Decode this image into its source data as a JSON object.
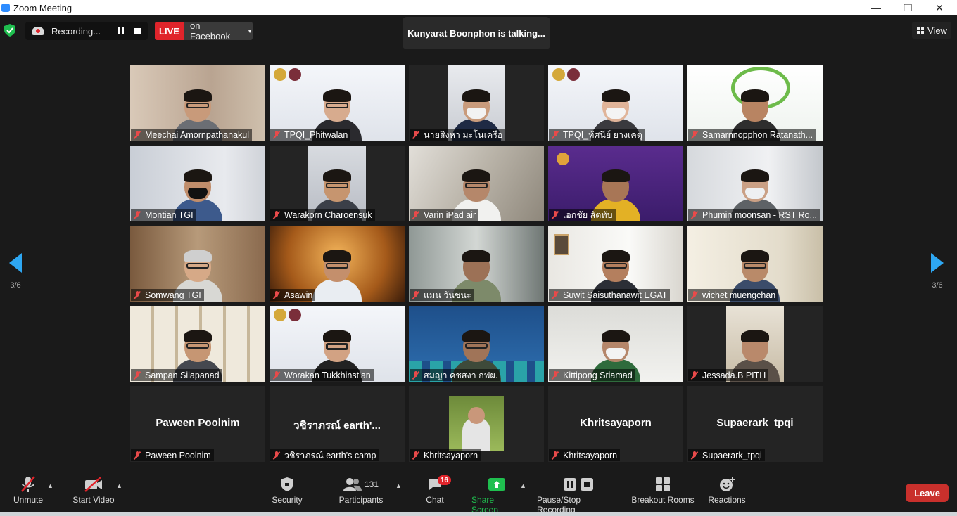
{
  "window": {
    "title": "Zoom Meeting",
    "minimize": "—",
    "maximize": "❐",
    "close": "✕"
  },
  "topbar": {
    "recording_label": "Recording...",
    "live_label": "LIVE",
    "live_target": "on Facebook",
    "talking": "Kunyarat Boonphon is talking...",
    "view_label": "View"
  },
  "pager": {
    "left_page": "3/6",
    "right_page": "3/6"
  },
  "tiles": [
    {
      "name": "Meechai Amornpathanakul"
    },
    {
      "name": "TPQI_Phitwalan"
    },
    {
      "name": "นายสิงหา มะโนเครือ"
    },
    {
      "name": "TPQI_ทัศนีย์ ยางเคตุ"
    },
    {
      "name": "Samarnnopphon Ratanath..."
    },
    {
      "name": "Montian TGI"
    },
    {
      "name": "Warakorn Charoensuk"
    },
    {
      "name": "Varin iPad air"
    },
    {
      "name": "เอกชัย สัตทับ"
    },
    {
      "name": "Phumin moonsan - RST Ro..."
    },
    {
      "name": "Somwang TGI"
    },
    {
      "name": "Asawin"
    },
    {
      "name": "แมน วันชนะ"
    },
    {
      "name": "Suwit Saisuthanawit EGAT"
    },
    {
      "name": "wichet muengchan"
    },
    {
      "name": "Sampan Silapanad"
    },
    {
      "name": "Worakan Tukkhinstian"
    },
    {
      "name": "สมญา คชสงา กฟผ."
    },
    {
      "name": "Kittipong Sriamad"
    },
    {
      "name": "Jessada.B PITH"
    },
    {
      "name": "Paween Poolnim",
      "display": "Paween Poolnim"
    },
    {
      "name": "วชิราภรณ์ earth's camp",
      "display": "วชิราภรณ์ earth'..."
    },
    {
      "name": "Khritsayaporn"
    },
    {
      "name": "Khritsayaporn",
      "display": "Khritsayaporn"
    },
    {
      "name": "Supaerark_tpqi",
      "display": "Supaerark_tpqi"
    }
  ],
  "toolbar": {
    "unmute": "Unmute",
    "start_video": "Start Video",
    "security": "Security",
    "participants": "Participants",
    "participants_count": "131",
    "chat": "Chat",
    "chat_badge": "16",
    "share_screen": "Share Screen",
    "pause_stop_recording": "Pause/Stop Recording",
    "breakout_rooms": "Breakout Rooms",
    "reactions": "Reactions",
    "leave": "Leave"
  },
  "colors": {
    "accent_green": "#1fbf4f",
    "live_red": "#e0242b",
    "pager_blue": "#2ea7f2",
    "leave_red": "#c9302c"
  }
}
